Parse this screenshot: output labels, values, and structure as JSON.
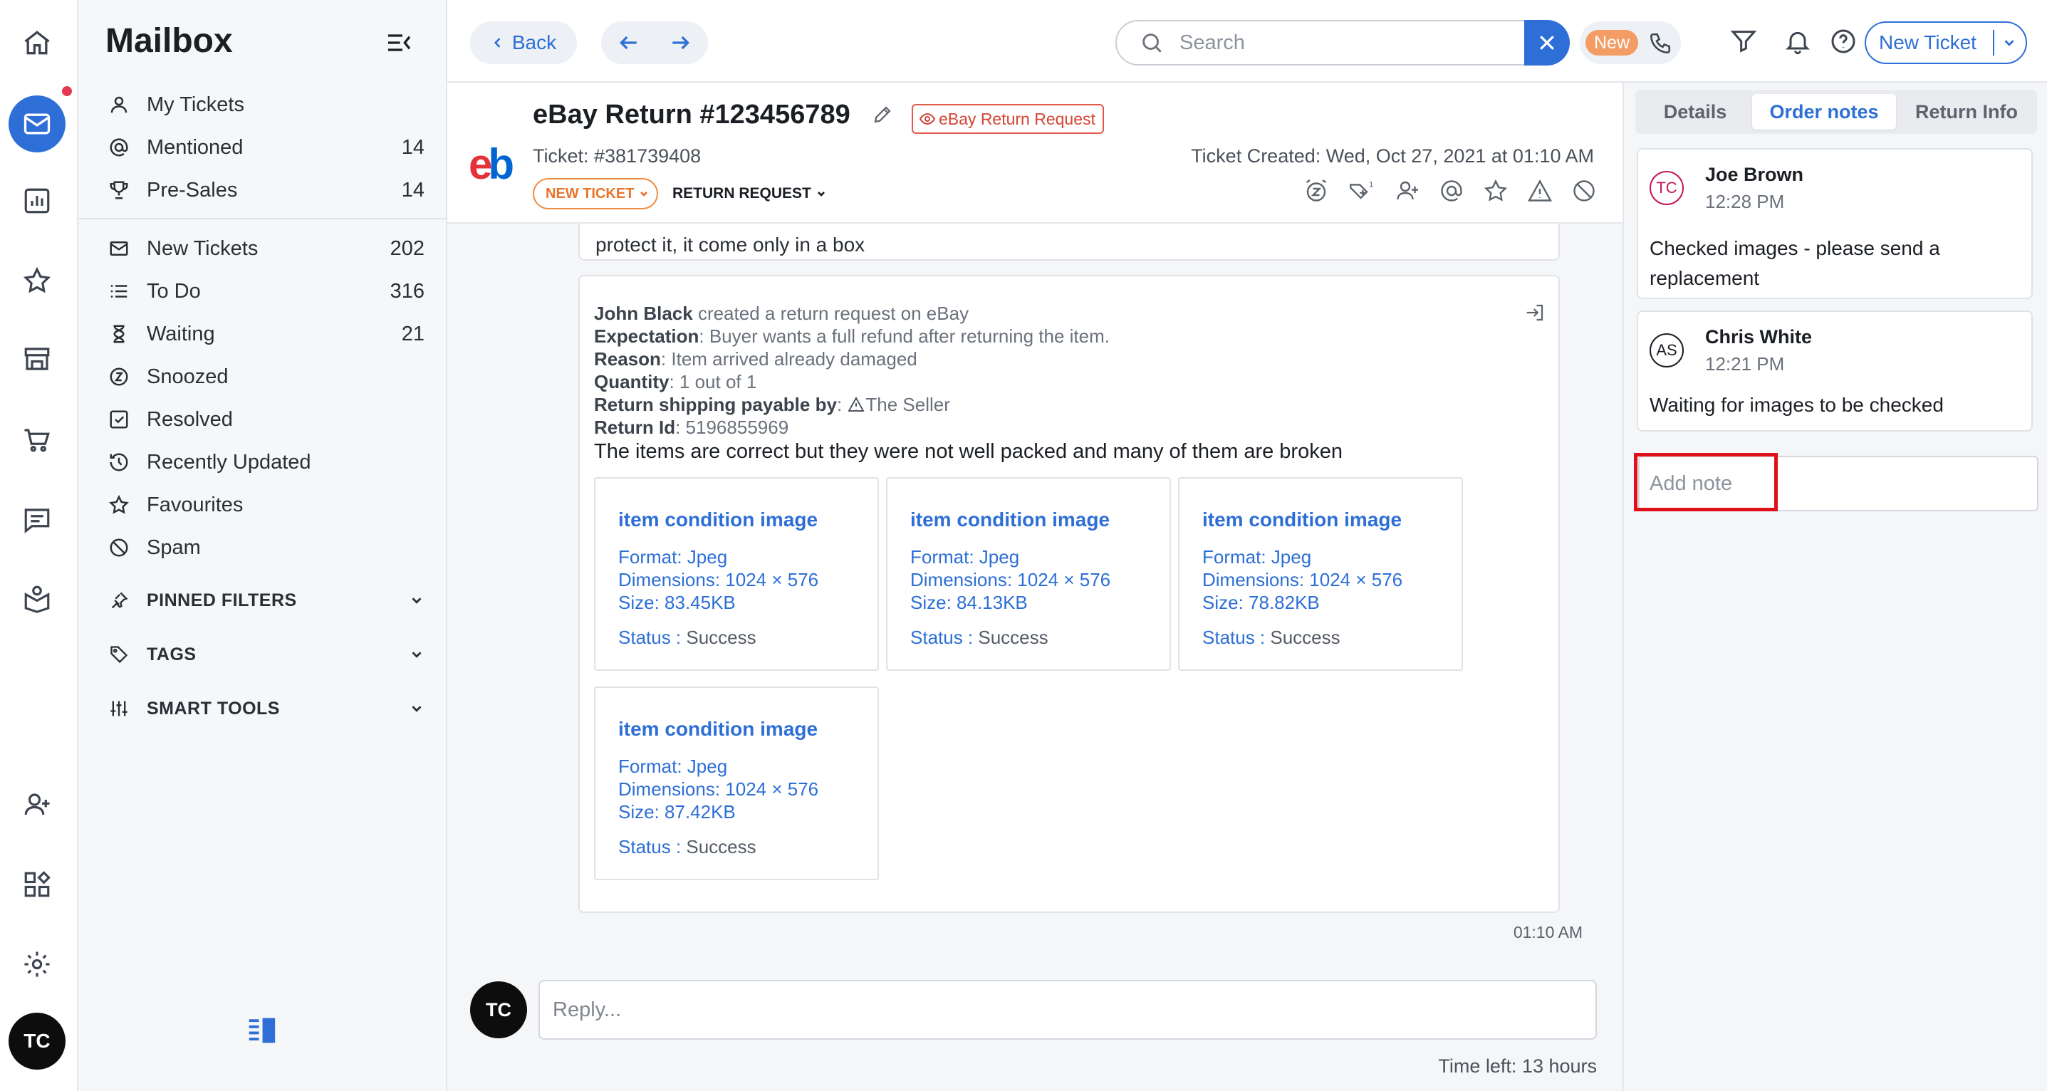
{
  "sidebar": {
    "title": "Mailbox",
    "items": [
      {
        "label": "My Tickets",
        "count": ""
      },
      {
        "label": "Mentioned",
        "count": "14"
      },
      {
        "label": "Pre-Sales",
        "count": "14"
      },
      {
        "label": "New Tickets",
        "count": "202"
      },
      {
        "label": "To Do",
        "count": "316"
      },
      {
        "label": "Waiting",
        "count": "21"
      },
      {
        "label": "Snoozed",
        "count": ""
      },
      {
        "label": "Resolved",
        "count": ""
      },
      {
        "label": "Recently Updated",
        "count": ""
      },
      {
        "label": "Favourites",
        "count": ""
      },
      {
        "label": "Spam",
        "count": ""
      }
    ],
    "sections": [
      {
        "label": "PINNED FILTERS"
      },
      {
        "label": "TAGS"
      },
      {
        "label": "SMART TOOLS"
      }
    ]
  },
  "rail": {
    "avatar": "TC"
  },
  "topbar": {
    "back": "Back",
    "search_placeholder": "Search",
    "new_badge": "New",
    "new_ticket": "New Ticket"
  },
  "ticket": {
    "logo_e": "e",
    "logo_b": "b",
    "title": "eBay Return #123456789",
    "tag": "eBay Return Request",
    "number": "Ticket: #381739408",
    "created": "Ticket Created: Wed, Oct 27, 2021 at 01:10 AM",
    "status": "NEW TICKET",
    "type": "RETURN REQUEST"
  },
  "thread": {
    "prev_text": "protect it, it come only in a box",
    "message": {
      "author": "John Black",
      "action": " created a return request on eBay",
      "expectation_label": "Expectation",
      "expectation": ": Buyer wants a full refund after returning the item.",
      "reason_label": "Reason",
      "reason": ": Item arrived already damaged",
      "quantity_label": "Quantity",
      "quantity": ": 1 out of 1",
      "shipping_label": "Return shipping payable by",
      "shipping": ": ",
      "shipping_value": "The Seller",
      "return_id_label": "Return Id",
      "return_id": ": 5196855969",
      "body": "The items are correct but they were not well packed and many of them are broken"
    },
    "images": [
      {
        "title": "item condition image",
        "format": "Format: Jpeg",
        "dimensions": "Dimensions: 1024 × 576",
        "size": "Size: 83.45KB",
        "status_label": "Status :",
        "status": " Success"
      },
      {
        "title": "item condition image",
        "format": "Format: Jpeg",
        "dimensions": "Dimensions: 1024 × 576",
        "size": "Size: 84.13KB",
        "status_label": "Status :",
        "status": " Success"
      },
      {
        "title": "item condition image",
        "format": "Format: Jpeg",
        "dimensions": "Dimensions: 1024 × 576",
        "size": "Size: 78.82KB",
        "status_label": "Status :",
        "status": " Success"
      },
      {
        "title": "item condition image",
        "format": "Format: Jpeg",
        "dimensions": "Dimensions: 1024 × 576",
        "size": "Size: 87.42KB",
        "status_label": "Status :",
        "status": " Success"
      }
    ],
    "time": "01:10 AM"
  },
  "reply": {
    "avatar": "TC",
    "placeholder": "Reply...",
    "time_left": "Time left: 13 hours"
  },
  "right_panel": {
    "tabs": [
      "Details",
      "Order notes",
      "Return Info"
    ],
    "notes": [
      {
        "initials": "TC",
        "name": "Joe Brown",
        "time": "12:28 PM",
        "text": "Checked images - please send a replacement",
        "color": "#c2185b"
      },
      {
        "initials": "AS",
        "name": "Chris White",
        "time": "12:21 PM",
        "text": "Waiting for images to be checked",
        "color": "#1b1f24"
      }
    ],
    "add_note_placeholder": "Add note"
  },
  "colors": {
    "accent": "#2d6fd6",
    "highlight": "#e0101a",
    "status_orange": "#e8742a",
    "tag_red": "#d34535"
  }
}
